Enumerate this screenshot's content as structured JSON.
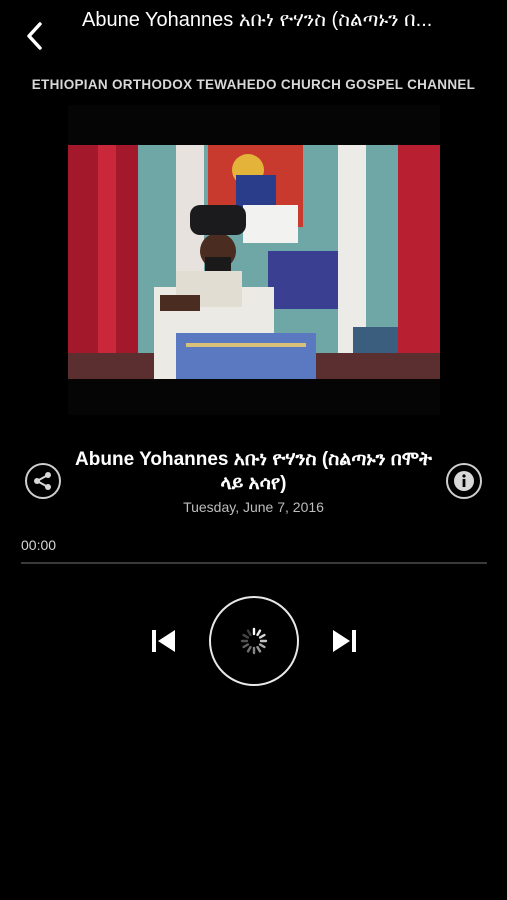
{
  "nav": {
    "title": "Abune Yohannes አቡነ ዮሃንስ (ስልጣኑን በ...",
    "back_icon": "chevron-left-icon"
  },
  "channel": {
    "name": "ETHIOPIAN ORTHODOX TEWAHEDO CHURCH GOSPEL CHANNEL"
  },
  "video": {
    "thumbnail": "video-thumbnail-priest-at-altar"
  },
  "track": {
    "title": "Abune Yohannes አቡነ ዮሃንስ (ስልጣኑን በሞት ላይ አሳየ)",
    "date": "Tuesday, June 7, 2016",
    "share_icon": "share-icon",
    "info_icon": "info-icon"
  },
  "player": {
    "current_time": "00:00",
    "progress": 0,
    "prev_icon": "skip-previous-icon",
    "play_state_icon": "loading-spinner-icon",
    "next_icon": "skip-next-icon"
  },
  "colors": {
    "background": "#000000",
    "text": "#ffffff",
    "muted_text": "#bdbdbd",
    "track_line": "#3a3a3a"
  }
}
